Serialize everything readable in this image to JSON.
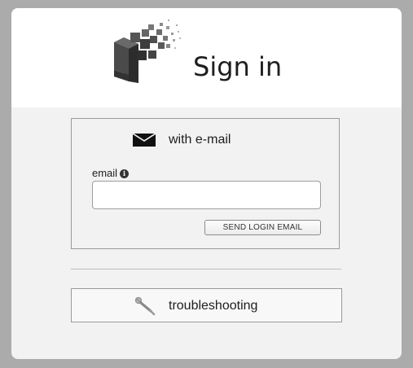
{
  "header": {
    "title": "Sign in",
    "logo_icon": "bitcoin-cubes-logo"
  },
  "email_panel": {
    "heading": "with e-mail",
    "heading_icon": "envelope-icon",
    "field_label": "email",
    "field_info_icon": "info-icon",
    "field_value": "",
    "field_placeholder": "",
    "send_button_label": "SEND LOGIN EMAIL"
  },
  "troubleshooting": {
    "label": "troubleshooting",
    "icon": "wrench-icon"
  },
  "colors": {
    "page_background": "#ababab",
    "card_background": "#f2f2f2",
    "header_background": "#ffffff",
    "text": "#1e1e1e"
  }
}
